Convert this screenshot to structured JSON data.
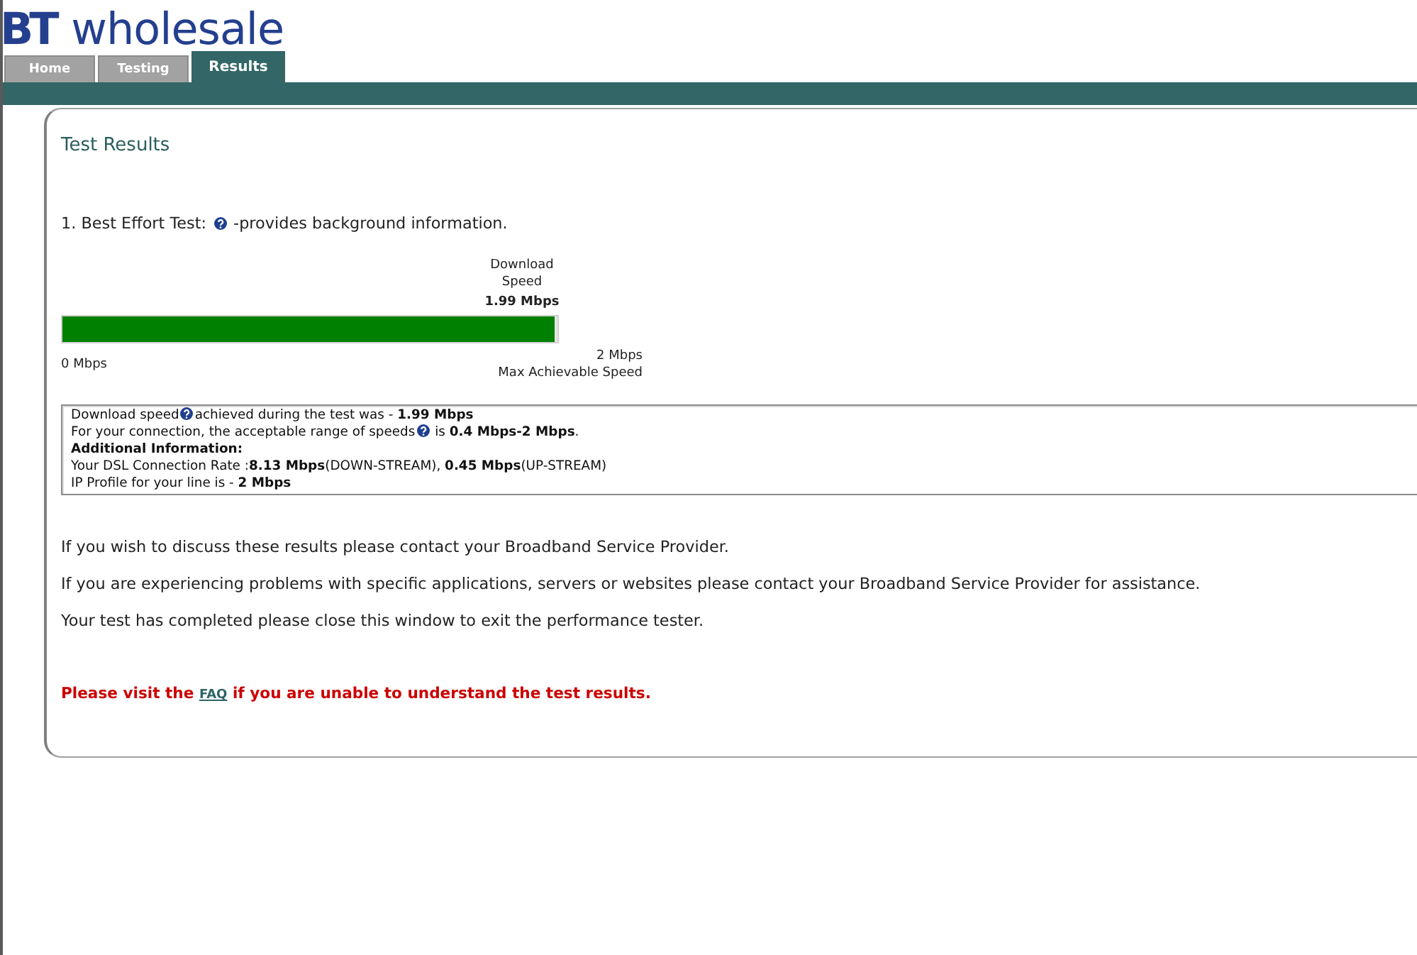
{
  "logo": {
    "text": "**BT** wholesale"
  },
  "tabs": [
    {
      "label": "Home",
      "selected": false
    },
    {
      "label": "Testing",
      "selected": false
    },
    {
      "label": "Results",
      "selected": true
    }
  ],
  "panel": {
    "title": "Test Results",
    "test_heading": [
      {
        "kind": "text",
        "text": "1. Best Effort Test:"
      },
      {
        "kind": "help"
      },
      {
        "kind": "text",
        "text": "-provides background information."
      }
    ],
    "meter": {
      "label": "Download Speed",
      "value": "1.99 Mbps",
      "level": 0.995,
      "min_label": "0 Mbps",
      "max_label": "2 Mbps",
      "max_caption": "Max Achievable Speed"
    },
    "info_lines": [
      {
        "bold": false,
        "segments": [
          {
            "kind": "text",
            "text": "Download speed"
          },
          {
            "kind": "help"
          },
          {
            "kind": "text",
            "text": "achieved during the test was - **1.99 Mbps**"
          }
        ]
      },
      {
        "bold": false,
        "segments": [
          {
            "kind": "text",
            "text": "For your connection, the acceptable range of speeds"
          },
          {
            "kind": "help"
          },
          {
            "kind": "text",
            "text": " is **0.4 Mbps-2 Mbps**."
          }
        ]
      },
      {
        "bold": true,
        "segments": [
          {
            "kind": "text",
            "text": "Additional Information:"
          }
        ]
      },
      {
        "bold": false,
        "segments": [
          {
            "kind": "text",
            "text": "Your DSL Connection Rate :**8.13 Mbps**(DOWN-STREAM), **0.45 Mbps**(UP-STREAM)"
          }
        ]
      },
      {
        "bold": false,
        "segments": [
          {
            "kind": "text",
            "text": "IP Profile for your line is - **2 Mbps**"
          }
        ]
      }
    ],
    "paragraphs": [
      "If you wish to discuss these results please contact your Broadband Service Provider.",
      "If you are experiencing problems with specific applications, servers or websites please contact your Broadband Service Provider for assistance.",
      "Your test has completed please close this window to exit the performance tester."
    ],
    "notice": {
      "before": "Please visit the",
      "link": "FAQ",
      "after": "if you are unable to understand the test results."
    }
  }
}
